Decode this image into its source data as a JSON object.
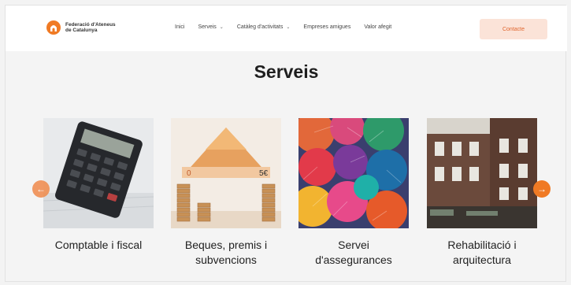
{
  "header": {
    "logo_line1": "Federació d'Ateneus",
    "logo_line2": "de Catalunya",
    "nav": [
      {
        "label": "Inici",
        "dropdown": false
      },
      {
        "label": "Serveis",
        "dropdown": true
      },
      {
        "label": "Catàleg d'activitats",
        "dropdown": true
      },
      {
        "label": "Empreses amigues",
        "dropdown": false
      },
      {
        "label": "Valor afegit",
        "dropdown": false
      }
    ],
    "contact_label": "Contacte"
  },
  "main": {
    "title": "Serveis",
    "cards": [
      {
        "label_line1": "Comptable i fiscal",
        "label_line2": "",
        "image": "calculator-photo"
      },
      {
        "label_line1": "Beques, premis i",
        "label_line2": "subvencions",
        "image": "banknote-house-photo"
      },
      {
        "label_line1": "Servei",
        "label_line2": "d'assegurances",
        "image": "umbrellas-photo"
      },
      {
        "label_line1": "Rehabilitació i",
        "label_line2": "arquitectura",
        "image": "building-photo"
      }
    ]
  },
  "carousel": {
    "prev_icon": "arrow-left-icon",
    "next_icon": "arrow-right-icon"
  },
  "colors": {
    "accent": "#f07a24",
    "contact_bg": "#fbe3d8"
  }
}
